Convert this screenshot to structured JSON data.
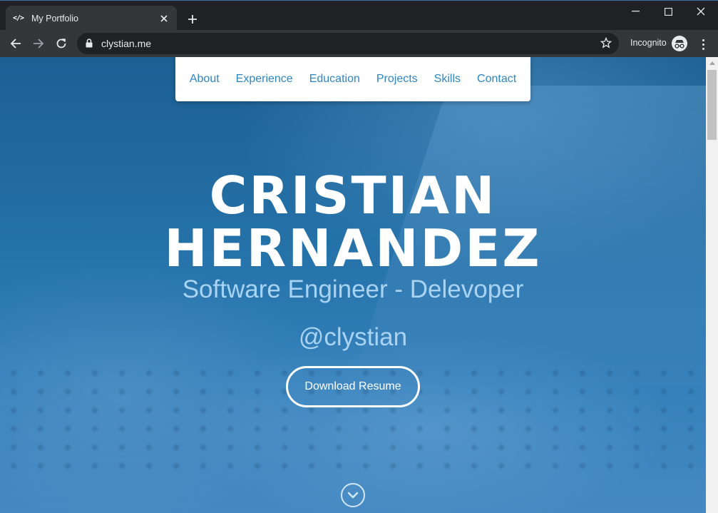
{
  "browser": {
    "tab_title": "My Portfolio",
    "tab_favicon": "</>",
    "url": "clystian.me",
    "incognito_label": "Incognito",
    "icons": {
      "close_tab": "close-icon",
      "new_tab": "plus-icon",
      "back": "arrow-left-icon",
      "forward": "arrow-right-icon",
      "reload": "reload-icon",
      "lock": "lock-icon",
      "bookmark": "star-icon",
      "incognito": "incognito-icon",
      "menu": "kebab-menu-icon",
      "minimize": "minimize-icon",
      "maximize": "maximize-icon",
      "close_window": "close-window-icon"
    }
  },
  "nav": {
    "items": [
      {
        "label": "About"
      },
      {
        "label": "Experience"
      },
      {
        "label": "Education"
      },
      {
        "label": "Projects"
      },
      {
        "label": "Skills"
      },
      {
        "label": "Contact"
      }
    ]
  },
  "hero": {
    "first_name": "CRISTIAN",
    "last_name": "HERNANDEZ",
    "subtitle": "Software Engineer - Delevoper",
    "handle": "@clystian",
    "resume_button": "Download Resume",
    "scroll_icon": "chevron-down-circle-icon"
  },
  "colors": {
    "accent": "#2e86c1",
    "hero_blue": "#2471a8",
    "subtitle": "#a9d3f2",
    "chrome_dark": "#202124",
    "chrome_toolbar": "#35363a"
  }
}
